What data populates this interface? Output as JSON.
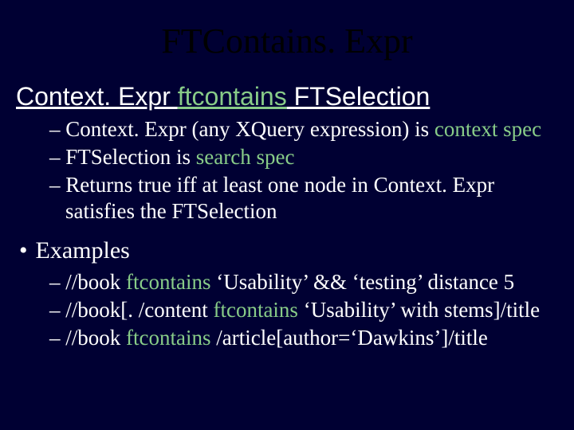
{
  "title": "FTContains. Expr",
  "heading": {
    "p1": "Context. Expr ",
    "kw": "ftcontains",
    "p2": " FTSelection"
  },
  "sub1": {
    "pre": "– Context. Expr (any XQuery expression) is ",
    "hl": "context spec"
  },
  "sub2": {
    "pre": "– FTSelection is ",
    "hl": "search spec"
  },
  "sub3": "– Returns true iff at least one node in Context. Expr satisfies the FTSelection",
  "examples_label": "Examples",
  "bullet_mark": "•",
  "ex1": {
    "pre": "– //book ",
    "kw": "ftcontains",
    "post": " ‘Usability’ && ‘testing’ distance 5"
  },
  "ex2": {
    "pre": "– //book[. /content ",
    "kw": "ftcontains",
    "post": " ‘Usability’ with stems]/title"
  },
  "ex3": {
    "pre": "– //book ",
    "kw": "ftcontains",
    "post": " /article[author=‘Dawkins’]/title"
  }
}
